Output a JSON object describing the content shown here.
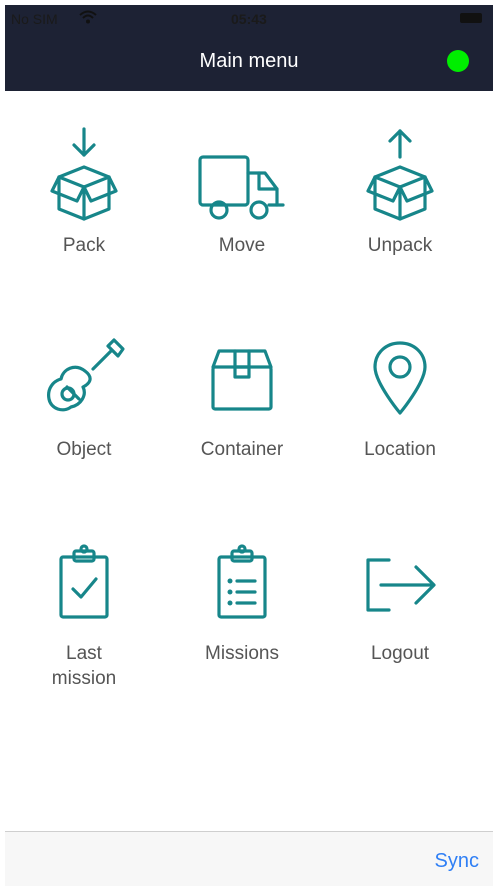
{
  "status_bar": {
    "carrier": "No SIM",
    "time": "05:43"
  },
  "header": {
    "title": "Main menu",
    "status_color": "#00ee00"
  },
  "menu": {
    "pack": "Pack",
    "move": "Move",
    "unpack": "Unpack",
    "object": "Object",
    "container": "Container",
    "location": "Location",
    "last_mission_line1": "Last",
    "last_mission_line2": "mission",
    "missions": "Missions",
    "logout": "Logout"
  },
  "bottom_bar": {
    "sync": "Sync"
  },
  "colors": {
    "header_bg": "#1d2234",
    "icon": "#17868a",
    "label": "#555555",
    "link": "#2f7ff5"
  }
}
